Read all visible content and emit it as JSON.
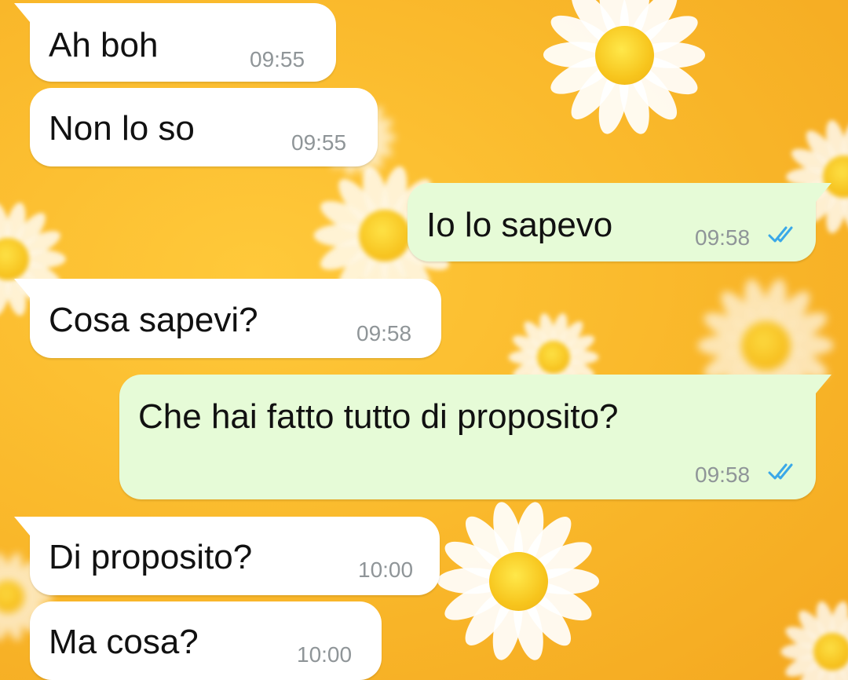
{
  "chat": {
    "messages": [
      {
        "direction": "incoming",
        "text": "Ah boh",
        "time": "09:55"
      },
      {
        "direction": "incoming",
        "text": "Non lo so",
        "time": "09:55"
      },
      {
        "direction": "outgoing",
        "text": "Io lo sapevo",
        "time": "09:58",
        "status": "read"
      },
      {
        "direction": "incoming",
        "text": "Cosa sapevi?",
        "time": "09:58"
      },
      {
        "direction": "outgoing",
        "text": "Che hai fatto tutto di proposito?",
        "time": "09:58",
        "status": "read"
      },
      {
        "direction": "incoming",
        "text": "Di proposito?",
        "time": "10:00"
      },
      {
        "direction": "incoming",
        "text": "Ma cosa?",
        "time": "10:00"
      }
    ]
  },
  "colors": {
    "wallpaper": "#f9b72a",
    "incoming_bubble": "#ffffff",
    "outgoing_bubble": "#e6fbd7",
    "read_ticks": "#3aa8e8",
    "timestamp": "#8f9598"
  },
  "icons": {
    "read_status": "double-check-icon",
    "wallpaper_motif": "daisy"
  }
}
